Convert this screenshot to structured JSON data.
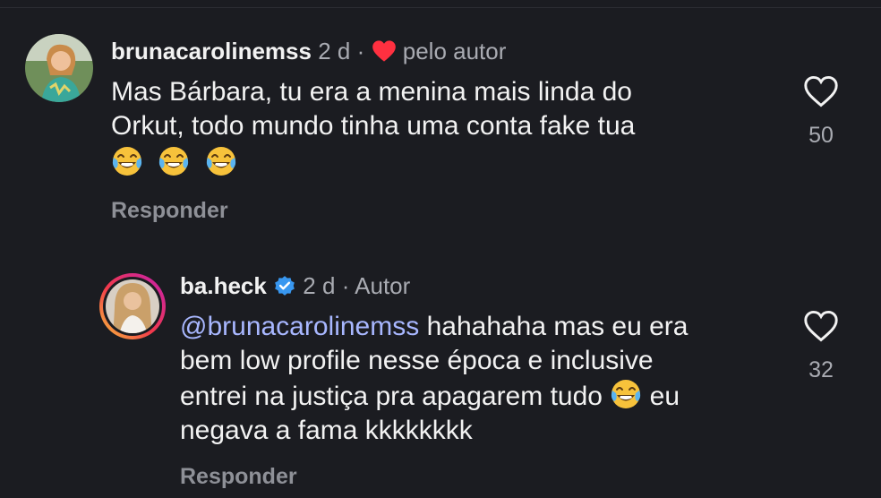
{
  "comments": [
    {
      "username": "brunacarolinemss",
      "time": "2 d",
      "separator": "·",
      "liked_by_label": "pelo autor",
      "text_line1": "Mas Bárbara, tu era a menina mais linda do",
      "text_line2": "Orkut, todo mundo tinha uma conta fake tua",
      "emojis": [
        "face-with-tears-of-joy",
        "face-with-tears-of-joy",
        "face-with-tears-of-joy"
      ],
      "likes": "50",
      "reply_label": "Responder",
      "icon": "heart-outline-icon"
    },
    {
      "username": "ba.heck",
      "verified": true,
      "time": "2 d",
      "separator": "·",
      "role_label": "Autor",
      "mention": "@brunacarolinemss",
      "text_line1_rest": "hahahaha mas eu era",
      "text_line2": "bem low profile nesse época e inclusive",
      "text_line3_a": "entrei na justiça pra apagarem tudo",
      "text_line3_b": "eu",
      "text_line4": "negava a fama kkkkkkkk",
      "likes": "32",
      "reply_label": "Responder",
      "icon": "heart-outline-icon"
    }
  ],
  "colors": {
    "background": "#1b1c21",
    "text": "#f2f2f2",
    "muted": "#a9abb2",
    "mention": "#a8b7ff",
    "heart": "#ff3040",
    "verified": "#3897f0"
  }
}
